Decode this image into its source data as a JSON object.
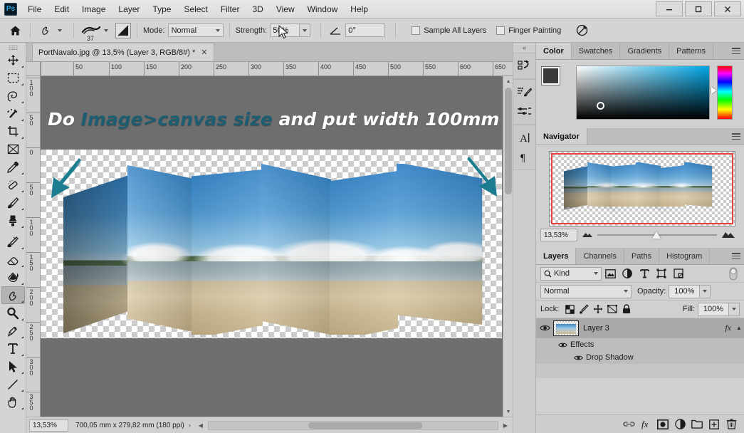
{
  "app": {
    "logo_text": "Ps"
  },
  "menubar": {
    "items": [
      {
        "label": "File"
      },
      {
        "label": "Edit"
      },
      {
        "label": "Image"
      },
      {
        "label": "Layer"
      },
      {
        "label": "Type"
      },
      {
        "label": "Select"
      },
      {
        "label": "Filter"
      },
      {
        "label": "3D"
      },
      {
        "label": "View"
      },
      {
        "label": "Window"
      },
      {
        "label": "Help"
      }
    ]
  },
  "window_controls": {
    "minimize": "—",
    "maximize": "❐",
    "close": "✕"
  },
  "options_bar": {
    "home_icon": "home-icon",
    "tool_preset_icon": "smudge-tool-preset-icon",
    "brush_size": "37",
    "brush_preset_icon": "brush-preset-icon",
    "toggle_panel_icon": "toggle-brush-panel-icon",
    "mode_label": "Mode:",
    "mode_value": "Normal",
    "strength_label": "Strength:",
    "strength_value": "50%",
    "angle_label": "angle-icon",
    "angle_value": "0°",
    "sample_all_layers": "Sample All Layers",
    "finger_painting": "Finger Painting",
    "pressure_icon": "tablet-pressure-icon"
  },
  "toolbar": {
    "tools": [
      {
        "name": "move-tool",
        "label": "Move Tool",
        "selected": false
      },
      {
        "name": "rectangular-marquee-tool",
        "label": "Rectangular Marquee Tool",
        "selected": false
      },
      {
        "name": "lasso-tool",
        "label": "Lasso Tool",
        "selected": false
      },
      {
        "name": "object-selection-tool",
        "label": "Object Selection Tool",
        "selected": false
      },
      {
        "name": "crop-tool",
        "label": "Crop Tool",
        "selected": false
      },
      {
        "name": "frame-tool",
        "label": "Frame Tool",
        "selected": false
      },
      {
        "name": "eyedropper-tool",
        "label": "Eyedropper Tool",
        "selected": false
      },
      {
        "name": "spot-healing-brush-tool",
        "label": "Spot Healing Brush Tool",
        "selected": false
      },
      {
        "name": "brush-tool",
        "label": "Brush Tool",
        "selected": false
      },
      {
        "name": "clone-stamp-tool",
        "label": "Clone Stamp Tool",
        "selected": false
      },
      {
        "name": "history-brush-tool",
        "label": "History Brush Tool",
        "selected": false
      },
      {
        "name": "eraser-tool",
        "label": "Eraser Tool",
        "selected": false
      },
      {
        "name": "gradient-tool",
        "label": "Gradient Tool",
        "selected": false
      },
      {
        "name": "smudge-tool",
        "label": "Smudge Tool",
        "selected": true
      },
      {
        "name": "dodge-tool",
        "label": "Dodge Tool",
        "selected": false
      },
      {
        "name": "pen-tool",
        "label": "Pen Tool",
        "selected": false
      },
      {
        "name": "horizontal-type-tool",
        "label": "Horizontal Type Tool",
        "selected": false
      },
      {
        "name": "path-selection-tool",
        "label": "Path Selection Tool",
        "selected": false
      },
      {
        "name": "line-tool",
        "label": "Line Tool",
        "selected": false
      },
      {
        "name": "hand-tool",
        "label": "Hand Tool",
        "selected": false
      }
    ]
  },
  "document_tab": {
    "title": "PortNavalo.jpg @ 13,5% (Layer 3, RGB/8#) *",
    "close": "✕"
  },
  "rulers": {
    "horizontal_units": [
      50,
      100,
      150,
      200,
      250,
      300,
      350,
      400,
      450,
      500,
      550,
      600,
      650
    ],
    "vertical_units": [
      100,
      50,
      0,
      50,
      100,
      150,
      200,
      250,
      300,
      350
    ]
  },
  "canvas": {
    "annotation": {
      "part1": "Do ",
      "highlight": "Image>canvas size",
      "part2": " and put width 100mm",
      "highlight_color": "#1d5d72",
      "text_color": "#ffffff"
    },
    "arrow_color": "#1d7d90",
    "arrow_left_name": "annotation-arrow-left",
    "arrow_right_name": "annotation-arrow-right",
    "image_description": "folded panorama of PortNavalo beach"
  },
  "status_bar": {
    "zoom": "13,53%",
    "doc_info": "700,05 mm x 279,82 mm (180 ppi)",
    "chevron": "›"
  },
  "rail": {
    "collapse_icon": "collapse-panels-icon",
    "buttons": [
      {
        "name": "history-panel-icon"
      },
      {
        "name": "brush-settings-panel-icon"
      },
      {
        "name": "brushes-panel-icon"
      },
      {
        "name": "adjustments-panel-icon"
      },
      {
        "name": "character-panel-icon"
      },
      {
        "name": "paragraph-panel-icon"
      }
    ]
  },
  "color_panel": {
    "tabs": [
      {
        "label": "Color",
        "active": true
      },
      {
        "label": "Swatches",
        "active": false
      },
      {
        "label": "Gradients",
        "active": false
      },
      {
        "label": "Patterns",
        "active": false
      }
    ],
    "foreground_color": "#3a3a3a",
    "background_color": "#ffffff",
    "picked_hue": "#00a6e6",
    "menu_icon": "panel-menu-icon"
  },
  "navigator_panel": {
    "tabs": [
      {
        "label": "Navigator",
        "active": true
      }
    ],
    "zoom_value": "13,53%",
    "menu_icon": "panel-menu-icon",
    "view_box_color": "#e8433f",
    "zoom_out_icon": "zoom-out-mountain-icon",
    "zoom_in_icon": "zoom-in-mountain-icon"
  },
  "layers_panel": {
    "tabs": [
      {
        "label": "Layers",
        "active": true
      },
      {
        "label": "Channels",
        "active": false
      },
      {
        "label": "Paths",
        "active": false
      },
      {
        "label": "Histogram",
        "active": false
      }
    ],
    "menu_icon": "panel-menu-icon",
    "filter": {
      "kind_label": "Kind",
      "search_icon": "search-icon",
      "filter_icons": [
        {
          "name": "filter-pixel-layers-icon"
        },
        {
          "name": "filter-adjustment-layers-icon"
        },
        {
          "name": "filter-type-layers-icon"
        },
        {
          "name": "filter-shape-layers-icon"
        },
        {
          "name": "filter-smart-object-layers-icon"
        }
      ],
      "toggle_name": "filter-toggle-switch"
    },
    "blend_mode": "Normal",
    "opacity_label": "Opacity:",
    "opacity_value": "100%",
    "lock_label": "Lock:",
    "lock_icons": [
      {
        "name": "lock-transparent-pixels-icon"
      },
      {
        "name": "lock-image-pixels-icon"
      },
      {
        "name": "lock-position-icon"
      },
      {
        "name": "lock-artboard-nesting-icon"
      },
      {
        "name": "lock-all-icon"
      }
    ],
    "fill_label": "Fill:",
    "fill_value": "100%",
    "layers": [
      {
        "name": "Layer 3",
        "visible": true,
        "selected": true,
        "fx_badge": "fx",
        "effects_label": "Effects",
        "effects": [
          {
            "label": "Drop Shadow",
            "visible": true
          }
        ]
      }
    ],
    "footer_buttons": [
      {
        "name": "link-layers-button",
        "glyph": "⚭"
      },
      {
        "name": "add-layer-style-button",
        "glyph": "fx"
      },
      {
        "name": "add-layer-mask-button",
        "glyph": "▣"
      },
      {
        "name": "new-fill-adjustment-layer-button",
        "glyph": "◐"
      },
      {
        "name": "new-group-button",
        "glyph": "▢"
      },
      {
        "name": "new-layer-button",
        "glyph": "⊞"
      },
      {
        "name": "delete-layer-button",
        "glyph": "Ὕ1"
      }
    ]
  }
}
